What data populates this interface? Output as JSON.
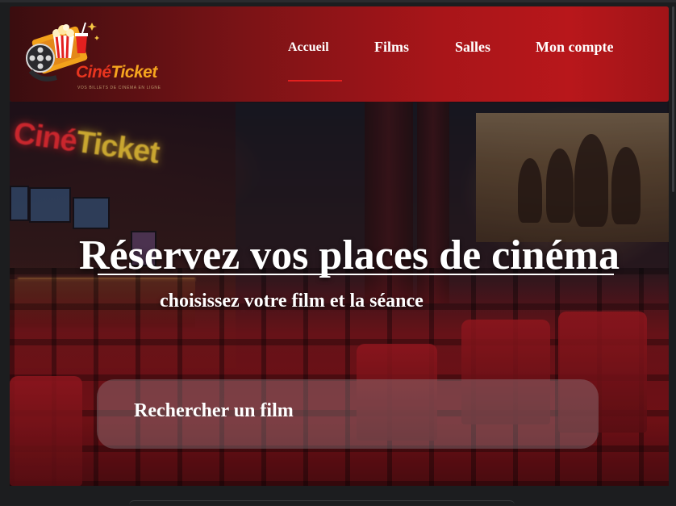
{
  "brand": {
    "name_part1": "Ciné",
    "name_part2": "Ticket",
    "tagline": "VOS BILLETS DE CINÉMA EN LIGNE",
    "accent_color": "#e3201f",
    "header_gradient_end": "#b8171b"
  },
  "nav": {
    "items": [
      {
        "label": "Accueil",
        "active": true
      },
      {
        "label": "Films",
        "active": false
      },
      {
        "label": "Salles",
        "active": false
      },
      {
        "label": "Mon compte",
        "active": false
      }
    ]
  },
  "hero": {
    "sign_part1": "Ciné",
    "sign_part2": "Ticket",
    "title": "Réservez vos places de cinéma",
    "subtitle": "choisissez votre film et la séance"
  },
  "search": {
    "placeholder": "Rechercher un film"
  }
}
